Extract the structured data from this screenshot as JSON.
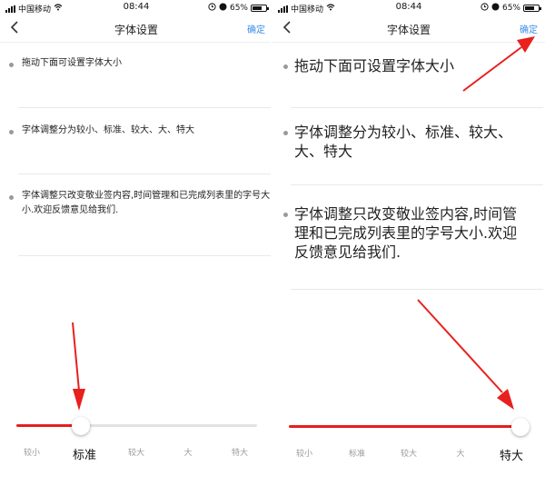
{
  "status_bar": {
    "carrier": "中国移动",
    "time": "08:44",
    "battery": "65%"
  },
  "nav": {
    "title": "字体设置",
    "confirm": "确定"
  },
  "tips": [
    "拖动下面可设置字体大小",
    "字体调整分为较小、标准、较大、大、特大",
    "字体调整只改变敬业签内容,时间管理和已完成列表里的字号大小.欢迎反馈意见给我们."
  ],
  "size_options": [
    "较小",
    "标准",
    "较大",
    "大",
    "特大"
  ],
  "left_panel": {
    "selected_option": "标准",
    "slider_value_fraction": 0.25
  },
  "right_panel": {
    "selected_option": "特大",
    "slider_value_fraction": 1.0
  },
  "colors": {
    "accent": "#e61e1e",
    "link": "#3a8ee6",
    "annotation_arrow": "#e8201e"
  }
}
